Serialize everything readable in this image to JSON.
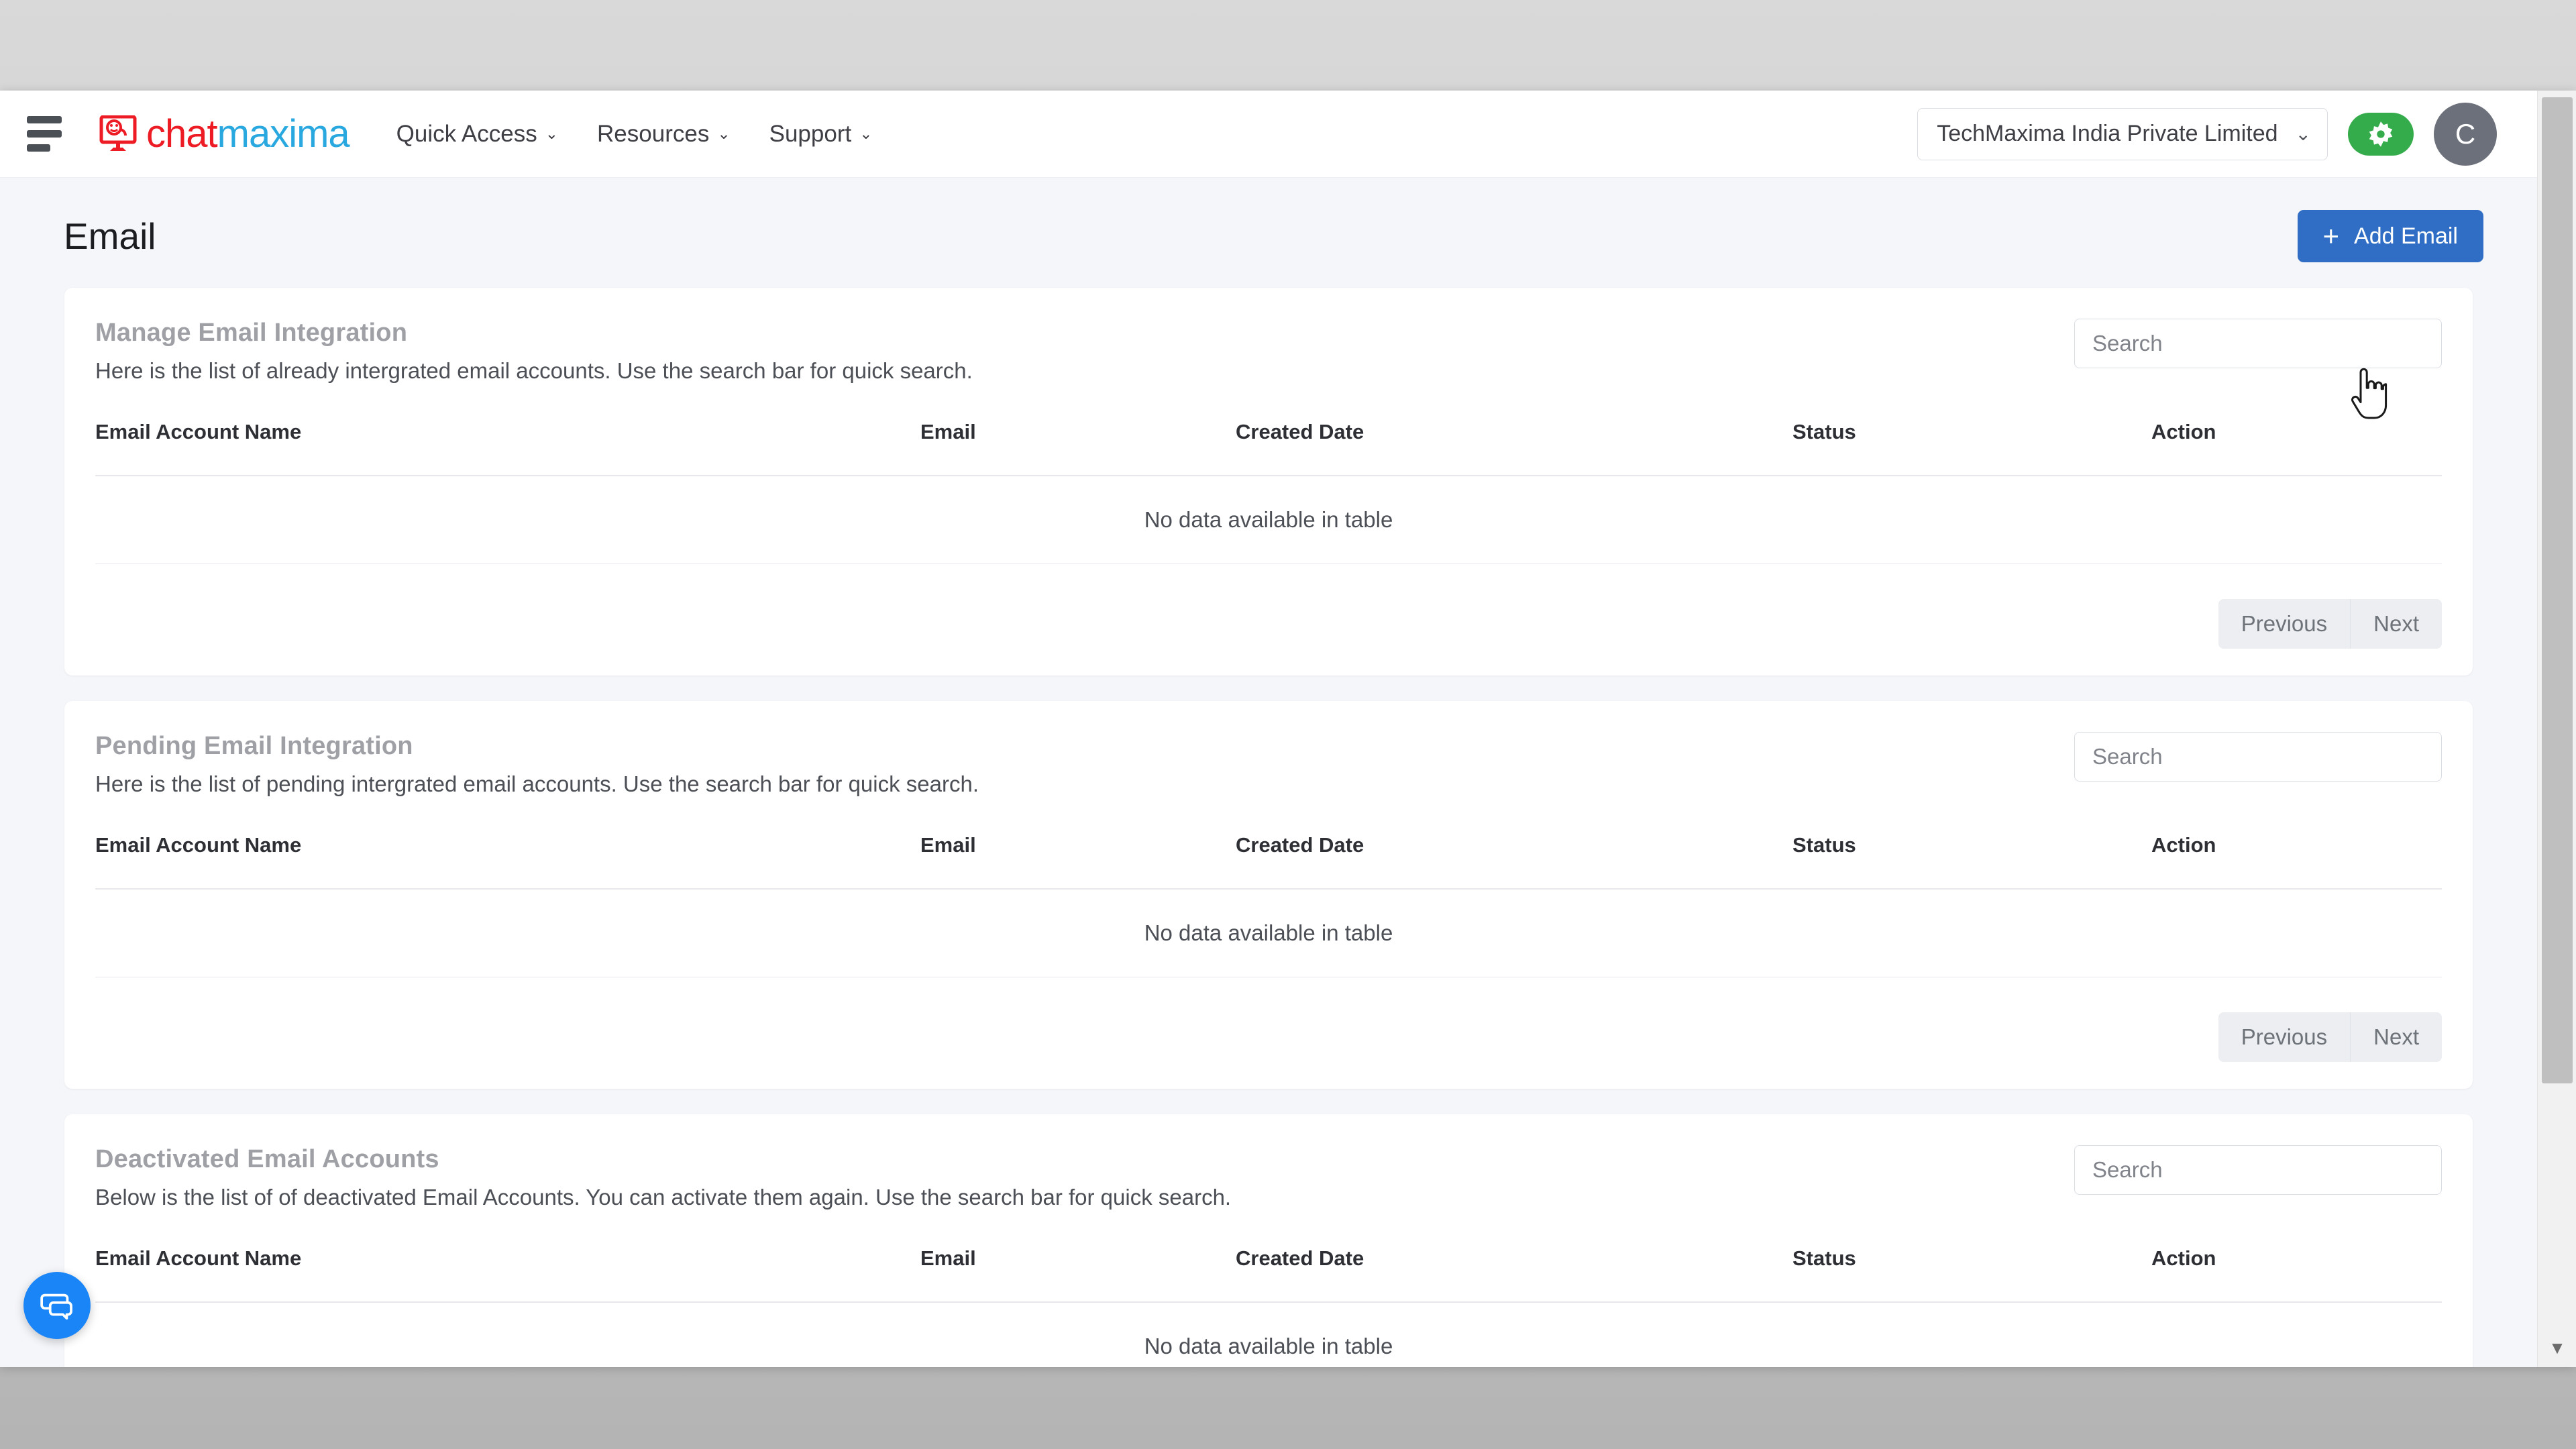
{
  "brand": {
    "part1": "chat",
    "part2": "maxima",
    "logo_icon": "chat-monitor-logo-icon"
  },
  "topbar": {
    "menu_icon": "hamburger-menu-icon",
    "nav": [
      {
        "label": "Quick Access",
        "caret": "⌄"
      },
      {
        "label": "Resources",
        "caret": "⌄"
      },
      {
        "label": "Support",
        "caret": "⌄"
      }
    ],
    "org": {
      "value": "TechMaxima India Private Limited",
      "caret": "⌄"
    },
    "settings_icon": "gear-icon",
    "avatar_initial": "C"
  },
  "page": {
    "title": "Email",
    "add_button": {
      "plus": "+",
      "label": "Add Email"
    }
  },
  "table_headers": [
    "Email Account Name",
    "Email",
    "Created Date",
    "Status",
    "Action"
  ],
  "empty_text": "No data available in table",
  "pagination": {
    "previous": "Previous",
    "next": "Next"
  },
  "search": {
    "placeholder": "Search",
    "value": ""
  },
  "cards": [
    {
      "title": "Manage Email Integration",
      "subtitle": "Here is the list of already intergrated email accounts. Use the search bar for quick search."
    },
    {
      "title": "Pending Email Integration",
      "subtitle": "Here is the list of pending intergrated email accounts. Use the search bar for quick search."
    },
    {
      "title": "Deactivated Email Accounts",
      "subtitle": "Below is the list of of deactivated Email Accounts. You can activate them again. Use the search bar for quick search."
    }
  ],
  "chat_launcher": {
    "icon": "chat-bubbles-icon"
  },
  "scrollbar": {
    "up_arrow": "▲",
    "down_arrow": "▼"
  },
  "colors": {
    "accent_blue": "#2f6ec4",
    "brand_red": "#ed1c24",
    "brand_blue": "#29a8e0",
    "settings_green": "#35ac4b",
    "chat_blue": "#1a85f7",
    "page_bg": "#f5f6fa"
  }
}
